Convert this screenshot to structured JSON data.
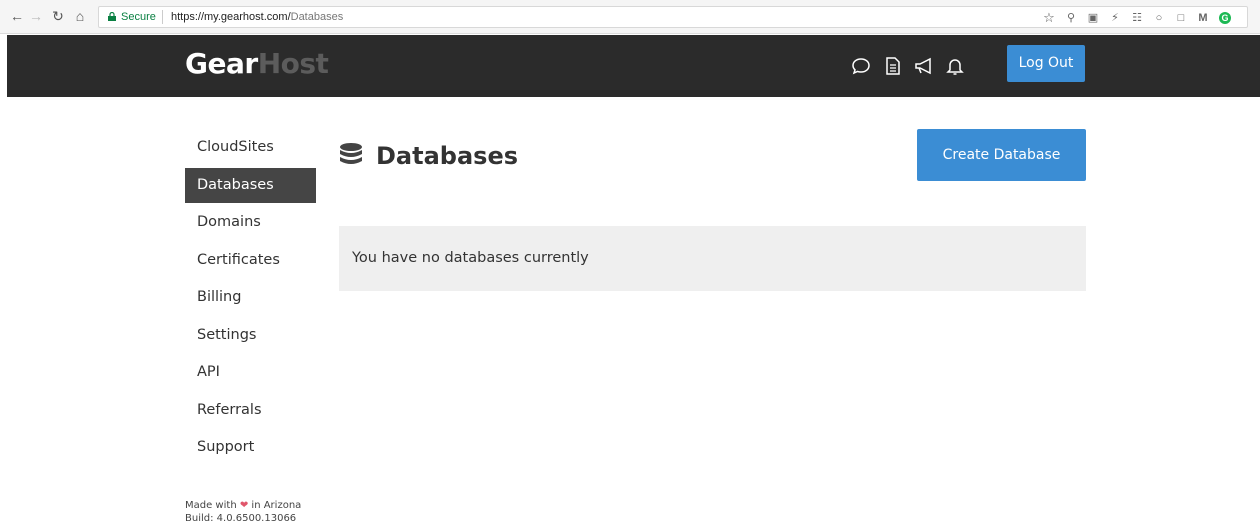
{
  "browser": {
    "secure_label": "Secure",
    "url_host": "https://my.gearhost.com/",
    "url_path": "Databases",
    "extensions": [
      "star-icon",
      "search-icon",
      "screenshot-icon",
      "bolt-icon",
      "translate-icon",
      "circle-icon",
      "square-icon",
      "m-icon",
      "grammarly-icon"
    ]
  },
  "header": {
    "logo_primary": "Gear",
    "logo_secondary": "Host",
    "icons": [
      "chat-icon",
      "document-icon",
      "megaphone-icon",
      "bell-icon"
    ],
    "logout_label": "Log Out",
    "background": "#2b2b2b",
    "accent": "#3b8dd4"
  },
  "sidebar": {
    "items": [
      {
        "label": "CloudSites",
        "active": false
      },
      {
        "label": "Databases",
        "active": true
      },
      {
        "label": "Domains",
        "active": false
      },
      {
        "label": "Certificates",
        "active": false
      },
      {
        "label": "Billing",
        "active": false
      },
      {
        "label": "Settings",
        "active": false
      },
      {
        "label": "API",
        "active": false
      },
      {
        "label": "Referrals",
        "active": false
      },
      {
        "label": "Support",
        "active": false
      }
    ]
  },
  "footer": {
    "made_with": "Made with",
    "in_location": "in Arizona",
    "build": "Build: 4.0.6500.13066"
  },
  "main": {
    "title": "Databases",
    "create_label": "Create Database",
    "empty_message": "You have no databases currently"
  }
}
